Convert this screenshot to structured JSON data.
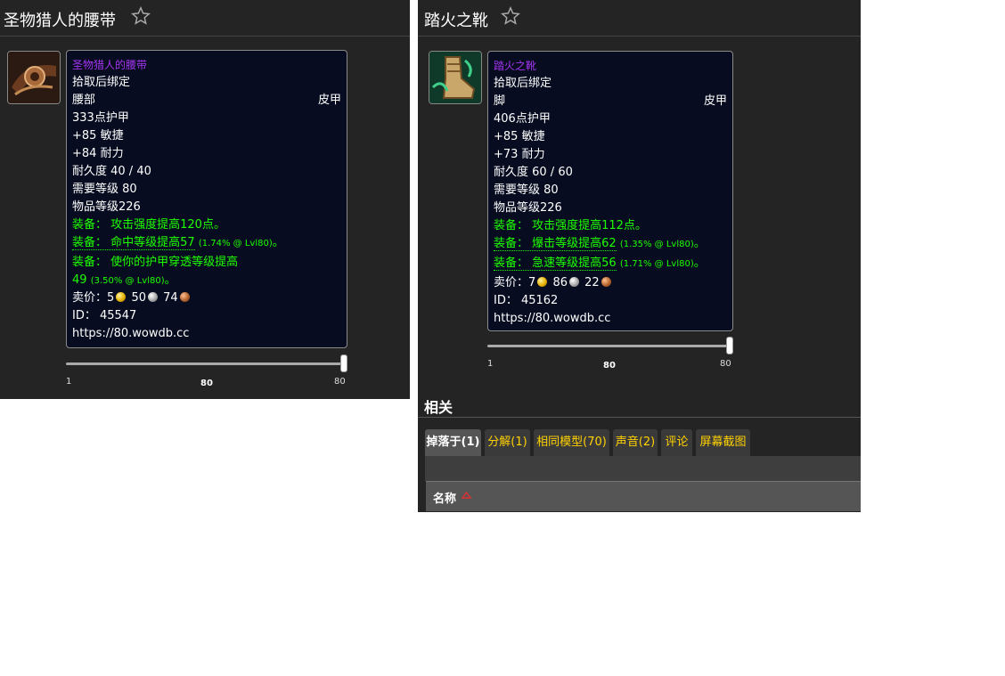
{
  "left": {
    "title": "圣物猎人的腰带",
    "tooltip": {
      "name": "圣物猎人的腰带",
      "bind": "拾取后绑定",
      "slot": "腰部",
      "type": "皮甲",
      "armor": "333点护甲",
      "stat1": "+85 敏捷",
      "stat2": "+84 耐力",
      "durability": "耐久度 40 / 40",
      "req_level": "需要等级 80",
      "item_level": "物品等级226",
      "equip1": "装备： 攻击强度提高120点。",
      "equip2_main": "装备： 命中等级提高57",
      "equip2_note": "(1.74% @ Lvl80)",
      "equip2_end": "。",
      "equip3_main": "装备： 使你的护甲穿透等级提高",
      "equip3_cont": "49",
      "equip3_note": "(3.50% @ Lvl80)",
      "equip3_end": "。",
      "sell_label": "卖价：",
      "sell_gold": "5",
      "sell_silver": "50",
      "sell_copper": "74",
      "id": "ID： 45547",
      "url": "https://80.wowdb.cc"
    },
    "slider": {
      "min": "1",
      "max": "80",
      "value": "80",
      "fraction": 1.0
    }
  },
  "right": {
    "title": "踏火之靴",
    "tooltip": {
      "name": "踏火之靴",
      "bind": "拾取后绑定",
      "slot": "脚",
      "type": "皮甲",
      "armor": "406点护甲",
      "stat1": "+85 敏捷",
      "stat2": "+73 耐力",
      "durability": "耐久度 60 / 60",
      "req_level": "需要等级 80",
      "item_level": "物品等级226",
      "equip1": "装备： 攻击强度提高112点。",
      "equip2_main": "装备： 爆击等级提高62",
      "equip2_note": "(1.35% @ Lvl80)",
      "equip2_end": "。",
      "equip3_main": "装备： 急速等级提高56",
      "equip3_note": "(1.71% @ Lvl80)",
      "equip3_end": "。",
      "sell_label": "卖价：",
      "sell_gold": "7",
      "sell_silver": "86",
      "sell_copper": "22",
      "id": "ID： 45162",
      "url": "https://80.wowdb.cc"
    },
    "slider": {
      "min": "1",
      "max": "80",
      "value": "80",
      "fraction": 1.0
    },
    "section_title": "相关",
    "tabs": [
      "掉落于(1)",
      "分解(1)",
      "相同模型(70)",
      "声音(2)",
      "评论",
      "屏幕截图"
    ],
    "active_tab": 0,
    "table_header": "名称"
  },
  "colors": {
    "panel_bg": "#242424",
    "tooltip_bg": "#070c20",
    "epic_purple": "#a335ee",
    "equip_green": "#1eff00",
    "tab_yellow": "#ffd100"
  }
}
